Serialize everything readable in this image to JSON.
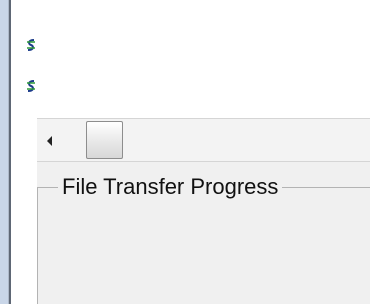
{
  "tree": {
    "items": [
      {
        "icon": "chain-link-icon",
        "label": ""
      },
      {
        "icon": "chain-link-icon",
        "label": ""
      }
    ]
  },
  "scrollbar": {
    "left_arrow_icon": "arrow-left-icon"
  },
  "group": {
    "title": "File Transfer Progress"
  },
  "colors": {
    "border": "#5e6775",
    "panel": "#f0f0f0",
    "strip": "#c9d6e8"
  }
}
